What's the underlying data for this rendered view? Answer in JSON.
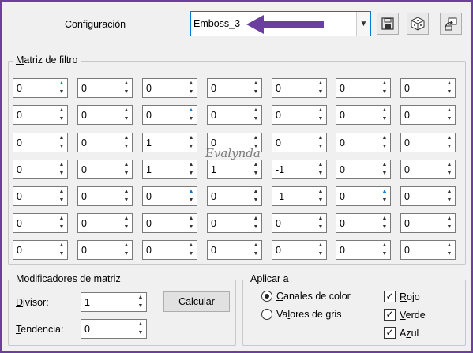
{
  "header": {
    "config_label": "Configuración",
    "preset_value": "Emboss_3",
    "save_icon": "save-icon",
    "random_icon": "dice-icon",
    "reset_icon": "reset-icon"
  },
  "matrix": {
    "title": "Matriz de filtro",
    "rows": [
      [
        "0",
        "0",
        "0",
        "0",
        "0",
        "0",
        "0"
      ],
      [
        "0",
        "0",
        "0",
        "0",
        "0",
        "0",
        "0"
      ],
      [
        "0",
        "0",
        "1",
        "0",
        "0",
        "0",
        "0"
      ],
      [
        "0",
        "0",
        "1",
        "1",
        "-1",
        "0",
        "0"
      ],
      [
        "0",
        "0",
        "0",
        "0",
        "-1",
        "0",
        "0"
      ],
      [
        "0",
        "0",
        "0",
        "0",
        "0",
        "0",
        "0"
      ],
      [
        "0",
        "0",
        "0",
        "0",
        "0",
        "0",
        "0"
      ]
    ],
    "watermark": "Evalynda"
  },
  "modifiers": {
    "title": "Modificadores de matriz",
    "divisor_label": "Divisor:",
    "divisor_value": "1",
    "bias_label": "Tendencia:",
    "bias_value": "0",
    "calc_label": "Calcular"
  },
  "apply": {
    "title": "Aplicar a",
    "radio_color": "Canales de color",
    "radio_gray": "Valores de gris",
    "check_red": "Rojo",
    "check_green": "Verde",
    "check_blue": "Azul"
  },
  "colors": {
    "accent": "#0078d7",
    "arrow": "#6b3fa0",
    "frame": "#6b3fa0"
  }
}
